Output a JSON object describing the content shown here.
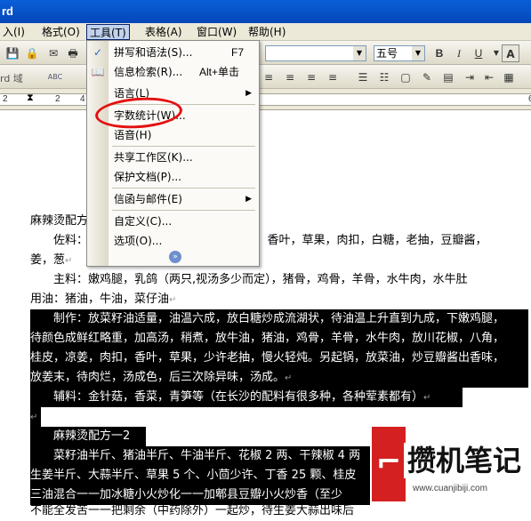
{
  "window": {
    "title_fragment": "rd"
  },
  "menubar": {
    "items": [
      "入(I)",
      "格式(O)",
      "工具(T)",
      "表格(A)",
      "窗口(W)",
      "帮助(H)"
    ],
    "active_index": 2
  },
  "toolbar": {
    "font_size": "五号",
    "bold": "B",
    "italic": "I",
    "underline": "U",
    "font_color": "A",
    "field_label": "rd 域",
    "abc_label": "ABC"
  },
  "ruler": {
    "numbers": [
      "2",
      "2",
      "4",
      "6"
    ]
  },
  "tools_menu": {
    "items": [
      {
        "icon": "spellcheck-icon",
        "glyph": "✓",
        "label": "拼写和语法(S)...",
        "shortcut": "F7",
        "submenu": false
      },
      {
        "icon": "research-icon",
        "glyph": "📖",
        "label": "信息检索(R)...",
        "shortcut": "Alt+单击",
        "submenu": false
      },
      {
        "icon": "",
        "glyph": "",
        "label": "语言(L)",
        "shortcut": "",
        "submenu": true
      },
      {
        "icon": "",
        "glyph": "",
        "label": "字数统计(W)...",
        "shortcut": "",
        "submenu": false
      },
      {
        "icon": "",
        "glyph": "",
        "label": "语音(H)",
        "shortcut": "",
        "submenu": false
      },
      {
        "icon": "",
        "glyph": "",
        "label": "共享工作区(K)...",
        "shortcut": "",
        "submenu": false
      },
      {
        "icon": "",
        "glyph": "",
        "label": "保护文档(P)...",
        "shortcut": "",
        "submenu": false
      },
      {
        "icon": "",
        "glyph": "",
        "label": "信函与邮件(E)",
        "shortcut": "",
        "submenu": true
      },
      {
        "icon": "",
        "glyph": "",
        "label": "自定义(C)...",
        "shortcut": "",
        "submenu": false
      },
      {
        "icon": "",
        "glyph": "",
        "label": "选项(O)...",
        "shortcut": "",
        "submenu": false
      }
    ],
    "highlighted_item": "字数统计(W)..."
  },
  "document": {
    "lines": [
      {
        "text": "麻辣烫配方一",
        "selected": false
      },
      {
        "text": "　　佐料：　　　　　　　　　　　　　凉姜，香叶，草果，肉扣，白糖，老抽，豆瓣酱，",
        "selected": false
      },
      {
        "text": "姜，葱",
        "selected": false
      },
      {
        "text": "　　主料：嫩鸡腿，乳鸽（两只,视汤多少而定），猪骨，鸡骨，羊骨，水牛肉，水牛肚",
        "selected": false
      },
      {
        "text": "用油：猪油，牛油，菜仔油",
        "selected": false
      },
      {
        "text": "　　制作：放菜籽油适量，油温六成，放白糖炒成流湖状，待油温上升直到九成，下嫩鸡腿，",
        "selected": true
      },
      {
        "text": "待颜色成鲜红略重，加高汤，稍煮，放牛油，猪油，鸡骨，羊骨，水牛肉，放川花椒，八角，",
        "selected": true
      },
      {
        "text": "桂皮，凉姜，肉扣，香叶，草果，少许老抽，慢火轻炖。另起锅，放菜油，炒豆瓣酱出香味，",
        "selected": true
      },
      {
        "text": "放姜末，待肉烂，汤成色，后三次除异味，汤成。",
        "selected": true
      },
      {
        "text": "　　辅料：金针菇，香菜，青笋等（在长沙的配料有很多种，各种荤素都有）",
        "selected": true
      },
      {
        "text": "",
        "selected": true
      },
      {
        "text": "　　麻辣烫配方一2",
        "selected": true
      },
      {
        "text": "　　菜籽油半斤、猪油半斤、牛油半斤、花椒 2 两、干辣椒 4 两",
        "selected": true
      },
      {
        "text": "生姜半斤、大蒜半斤、草果 5 个、小茴少许、丁香 25 颗、桂皮",
        "selected": true
      },
      {
        "text": "三油混合一一加冰糖小火炒化一一加郫县豆瓣小火炒香（至少",
        "selected": true
      },
      {
        "text": "不能全发苦一一把剩余（中药除外）一起炒，待生姜大蒜出味后",
        "selected": false
      }
    ]
  },
  "watermark": {
    "brand": "攒机笔记",
    "url": "www.cuanjibiji.com"
  }
}
